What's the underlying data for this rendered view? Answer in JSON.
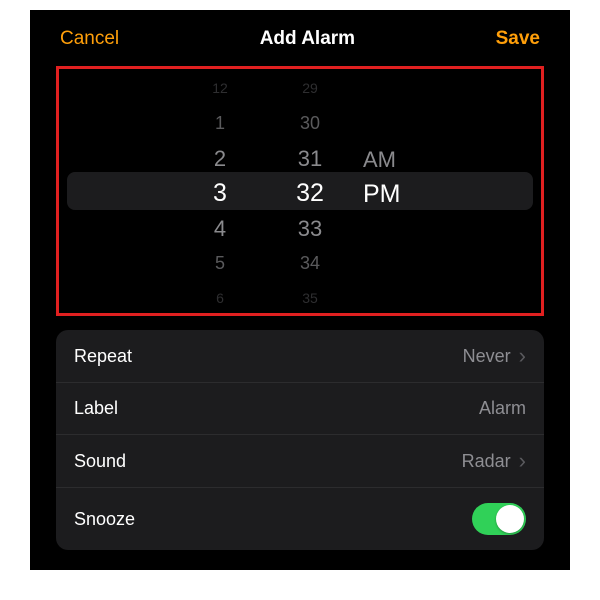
{
  "header": {
    "cancel_label": "Cancel",
    "title": "Add Alarm",
    "save_label": "Save"
  },
  "picker": {
    "hours": {
      "minus3": "12",
      "minus2": "1",
      "minus1": "2",
      "selected": "3",
      "plus1": "4",
      "plus2": "5",
      "plus3": "6"
    },
    "minutes": {
      "minus3": "29",
      "minus2": "30",
      "minus1": "31",
      "selected": "32",
      "plus1": "33",
      "plus2": "34",
      "plus3": "35"
    },
    "ampm": {
      "other": "AM",
      "selected": "PM"
    }
  },
  "settings": {
    "repeat": {
      "label": "Repeat",
      "value": "Never"
    },
    "label": {
      "label": "Label",
      "value": "Alarm"
    },
    "sound": {
      "label": "Sound",
      "value": "Radar"
    },
    "snooze": {
      "label": "Snooze",
      "on": true
    }
  },
  "colors": {
    "accent": "#ff9f0a",
    "toggle_on": "#30d158",
    "highlight_box": "#e12020"
  }
}
